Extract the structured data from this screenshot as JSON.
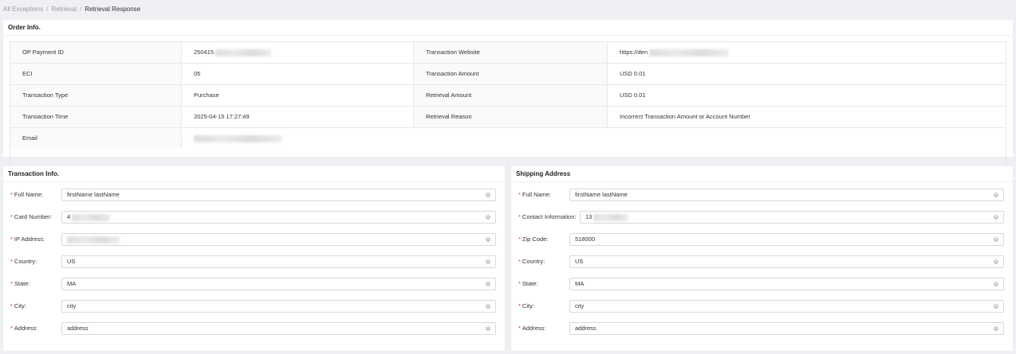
{
  "breadcrumb": [
    "All Exceptions",
    "Retrieval",
    "Retrieval Response"
  ],
  "order_info": {
    "title": "Order Info.",
    "rows": [
      {
        "label1": "OP Payment ID",
        "value1": "250415",
        "label2": "Transaction Website",
        "value2": "https://den"
      },
      {
        "label1": "ECI",
        "value1": "05",
        "label2": "Transaction Amount",
        "value2": "USD 0.01"
      },
      {
        "label1": "Transaction Type",
        "value1": "Purchase",
        "label2": "Retrieval Amount",
        "value2": "USD 0.01"
      },
      {
        "label1": "Transaction Time",
        "value1": "2025-04-15 17:27:49",
        "label2": "Retrieval Reason",
        "value2": "Incorrect Transaction Amount or Account Number"
      },
      {
        "label1": "Email",
        "value1": ""
      }
    ]
  },
  "transaction_info": {
    "title": "Transaction Info.",
    "fields": [
      {
        "label": "Full Name",
        "value": "firstName lastName"
      },
      {
        "label": "Card Number",
        "value": "4"
      },
      {
        "label": "IP Address",
        "value": ""
      },
      {
        "label": "Country",
        "value": "US"
      },
      {
        "label": "State",
        "value": "MA"
      },
      {
        "label": "City",
        "value": "city"
      },
      {
        "label": "Address",
        "value": "address"
      }
    ]
  },
  "shipping_address": {
    "title": "Shipping Address",
    "fields": [
      {
        "label": "Full Name",
        "value": "firstName lastName"
      },
      {
        "label": "Contact Information",
        "value": "13"
      },
      {
        "label": "Zip Code",
        "value": "518000"
      },
      {
        "label": "Country",
        "value": "US"
      },
      {
        "label": "State",
        "value": "MA"
      },
      {
        "label": "City",
        "value": "city"
      },
      {
        "label": "Address",
        "value": "address"
      }
    ]
  },
  "required_mark": "*",
  "label_colon": ":",
  "colors": {
    "required": "#f5222d",
    "background": "#eef0f3"
  },
  "icons": {
    "clear": "close-circle-icon"
  }
}
